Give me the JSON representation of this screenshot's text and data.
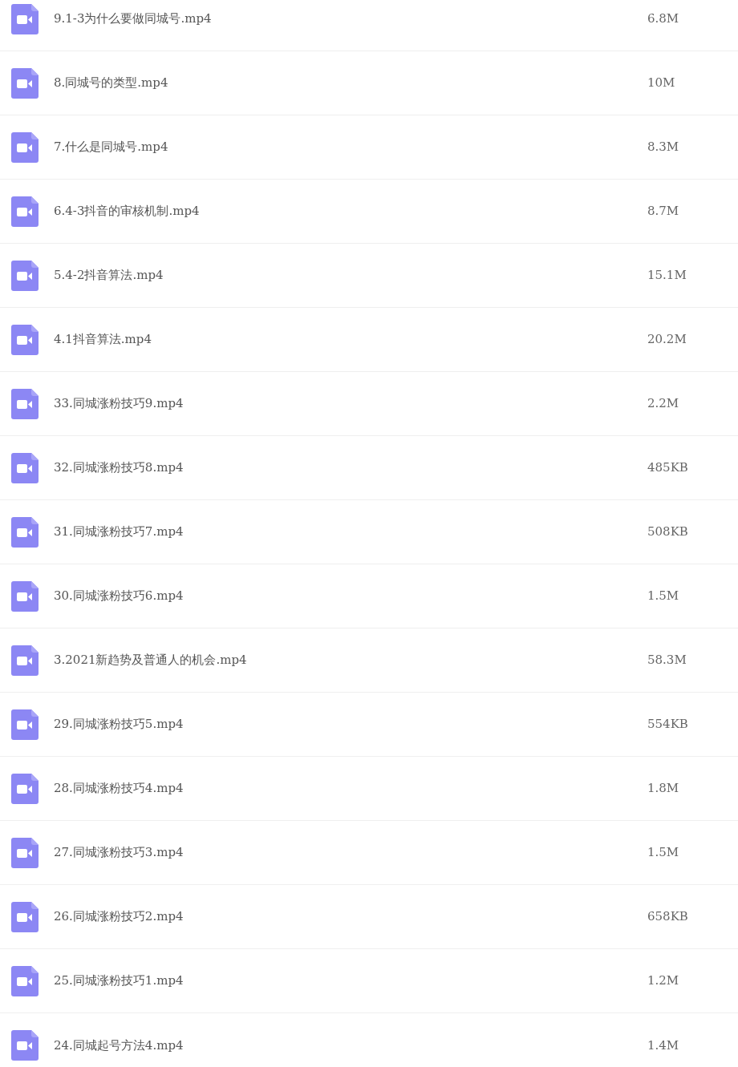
{
  "files": [
    {
      "name": "9.1-3为什么要做同城号.mp4",
      "size": "6.8M"
    },
    {
      "name": "8.同城号的类型.mp4",
      "size": "10M"
    },
    {
      "name": "7.什么是同城号.mp4",
      "size": "8.3M"
    },
    {
      "name": "6.4-3抖音的审核机制.mp4",
      "size": "8.7M"
    },
    {
      "name": "5.4-2抖音算法.mp4",
      "size": "15.1M"
    },
    {
      "name": "4.1抖音算法.mp4",
      "size": "20.2M"
    },
    {
      "name": "33.同城涨粉技巧9.mp4",
      "size": "2.2M"
    },
    {
      "name": "32.同城涨粉技巧8.mp4",
      "size": "485KB"
    },
    {
      "name": "31.同城涨粉技巧7.mp4",
      "size": "508KB"
    },
    {
      "name": "30.同城涨粉技巧6.mp4",
      "size": "1.5M"
    },
    {
      "name": "3.2021新趋势及普通人的机会.mp4",
      "size": "58.3M"
    },
    {
      "name": "29.同城涨粉技巧5.mp4",
      "size": "554KB"
    },
    {
      "name": "28.同城涨粉技巧4.mp4",
      "size": "1.8M"
    },
    {
      "name": "27.同城涨粉技巧3.mp4",
      "size": "1.5M"
    },
    {
      "name": "26.同城涨粉技巧2.mp4",
      "size": "658KB"
    },
    {
      "name": "25.同城涨粉技巧1.mp4",
      "size": "1.2M"
    },
    {
      "name": "24.同城起号方法4.mp4",
      "size": "1.4M"
    }
  ]
}
